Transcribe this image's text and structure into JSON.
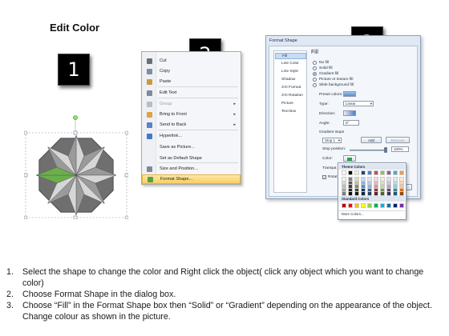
{
  "title": "Edit Color",
  "steps": [
    "1",
    "2",
    "3"
  ],
  "context_menu": {
    "items": [
      {
        "label": "Cut",
        "icon": "scissors-icon",
        "color": "#6a6f78"
      },
      {
        "label": "Copy",
        "icon": "copy-icon",
        "color": "#7e8ea6"
      },
      {
        "label": "Paste",
        "icon": "paste-icon",
        "color": "#c89a45"
      },
      {
        "label": "Edit Text",
        "icon": "edit-text-icon",
        "color": "#7d8aa1"
      },
      {
        "label": "Group",
        "icon": "group-icon",
        "color": "#b8bec8",
        "disabled": true,
        "submenu": true
      },
      {
        "label": "Bring to Front",
        "icon": "bring-to-front-icon",
        "color": "#e1a240",
        "submenu": true
      },
      {
        "label": "Send to Back",
        "icon": "send-to-back-icon",
        "color": "#5b82c4",
        "submenu": true
      },
      {
        "label": "Hyperlink...",
        "icon": "hyperlink-icon",
        "color": "#3f7bc8"
      },
      {
        "label": "Save as Picture...",
        "icon": "",
        "color": ""
      },
      {
        "label": "Set as Default Shape",
        "icon": "",
        "color": ""
      },
      {
        "label": "Size and Position...",
        "icon": "size-position-icon",
        "color": "#7b8aa3"
      },
      {
        "label": "Format Shape...",
        "icon": "format-shape-icon",
        "color": "#5a9e4a",
        "highlight": true
      }
    ]
  },
  "dialog": {
    "title": "Format Shape",
    "nav": [
      "Fill",
      "Line Color",
      "Line Style",
      "Shadow",
      "3-D Format",
      "3-D Rotation",
      "Picture",
      "Text Box"
    ],
    "pane_title": "Fill",
    "fill_options": [
      {
        "label": "No fill",
        "selected": false
      },
      {
        "label": "Solid fill",
        "selected": false
      },
      {
        "label": "Gradient fill",
        "selected": true
      },
      {
        "label": "Picture or texture fill",
        "selected": false
      },
      {
        "label": "Slide background fill",
        "selected": false
      }
    ],
    "preset_colors_label": "Preset colors:",
    "type_label": "Type:",
    "type_value": "Linear",
    "direction_label": "Direction:",
    "angle_label": "Angle:",
    "angle_value": "0°",
    "gradient_stops_label": "Gradient stops",
    "stop_value": "Stop 1",
    "add_label": "Add",
    "remove_label": "Remove",
    "stop_position_label": "Stop position:",
    "stop_position_value": "100%",
    "color_label": "Color:",
    "transparency_label": "Transpa",
    "rotate_label": "Rotat",
    "close_label": "se"
  },
  "palette": {
    "theme_label": "Theme Colors",
    "standard_label": "Standard Colors",
    "more_label": "More Colors...",
    "theme_top": [
      "#ffffff",
      "#000000",
      "#eeece1",
      "#1f497d",
      "#4f81bd",
      "#c0504d",
      "#9bbb59",
      "#8064a2",
      "#4bacc6",
      "#f79646"
    ],
    "theme_shades": [
      [
        "#f2f2f2",
        "#7f7f7f",
        "#ddd9c3",
        "#c6d9f0",
        "#dbe5f1",
        "#f2dcdb",
        "#ebf1dd",
        "#e5e0ec",
        "#dbeef3",
        "#fdeada"
      ],
      [
        "#d8d8d8",
        "#595959",
        "#c4bd97",
        "#8db3e2",
        "#b8cce4",
        "#e5b9b7",
        "#d7e3bc",
        "#ccc1d9",
        "#b7dde8",
        "#fbd5b5"
      ],
      [
        "#bfbfbf",
        "#3f3f3f",
        "#938953",
        "#548dd4",
        "#95b3d7",
        "#d99694",
        "#c3d69b",
        "#b2a2c7",
        "#92cddc",
        "#fac08f"
      ],
      [
        "#a5a5a5",
        "#262626",
        "#494429",
        "#17365d",
        "#366092",
        "#953734",
        "#76923c",
        "#5f497a",
        "#31859b",
        "#e36c09"
      ],
      [
        "#7f7f7f",
        "#0c0c0c",
        "#1d1b10",
        "#0f243e",
        "#244061",
        "#632423",
        "#4f6128",
        "#3f3151",
        "#205867",
        "#974806"
      ]
    ],
    "standard": [
      "#c00000",
      "#ff0000",
      "#ffc000",
      "#ffff00",
      "#92d050",
      "#00b050",
      "#00b0f0",
      "#0070c0",
      "#002060",
      "#7030a0"
    ]
  },
  "shape": {
    "star_color": "#a8a8a8",
    "octagon_color": "#6f6f6f",
    "highlight_color": "#6ab04a"
  },
  "instructions": [
    {
      "num": "1.",
      "text": "Select the shape to change the color and Right click the object( click any object which you want to change color)"
    },
    {
      "num": "2.",
      "text": "Choose Format Shape in the dialog box."
    },
    {
      "num": "3.",
      "text": "Choose “Fill” in the Format Shape box then “Solid” or “Gradient” depending on the appearance of the object. Change colour as shown in the picture."
    }
  ]
}
